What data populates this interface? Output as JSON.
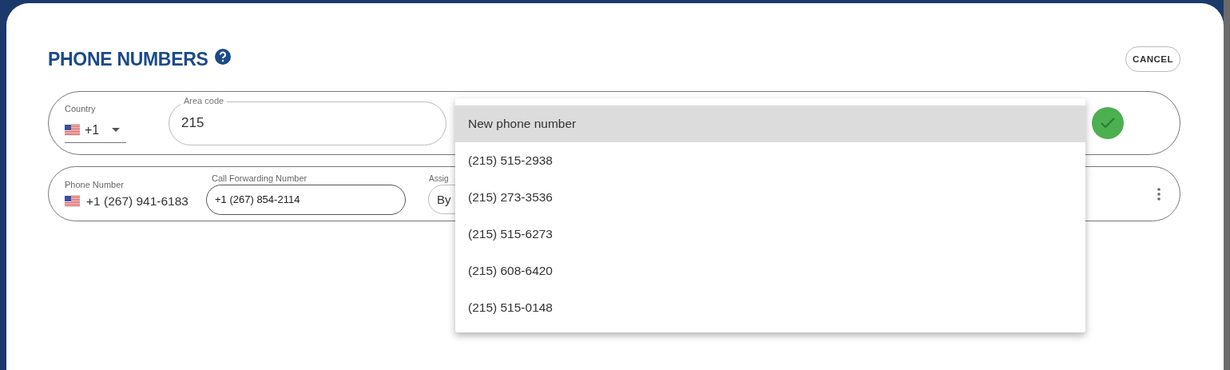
{
  "dialog": {
    "title": "PHONE NUMBERS",
    "cancel_button": "CANCEL"
  },
  "new_number_row": {
    "country": {
      "label": "Country",
      "value": "+1"
    },
    "area_code": {
      "label": "Area code",
      "value": "215"
    },
    "confirmed": true
  },
  "number_rows": [
    {
      "phone_label": "Phone Number",
      "phone": "+1 (267) 941-6183",
      "forwarding_label": "Call Forwarding Number",
      "forwarding": "+1 (267) 854-2114",
      "assign_label": "Assig",
      "assign_value": "By"
    }
  ],
  "dropdown": {
    "options": [
      {
        "label": "New phone number",
        "selected": true
      },
      {
        "label": "(215) 515-2938",
        "selected": false
      },
      {
        "label": "(215) 273-3536",
        "selected": false
      },
      {
        "label": "(215) 515-6273",
        "selected": false
      },
      {
        "label": "(215) 608-6420",
        "selected": false
      },
      {
        "label": "(215) 515-0148",
        "selected": false
      }
    ]
  }
}
